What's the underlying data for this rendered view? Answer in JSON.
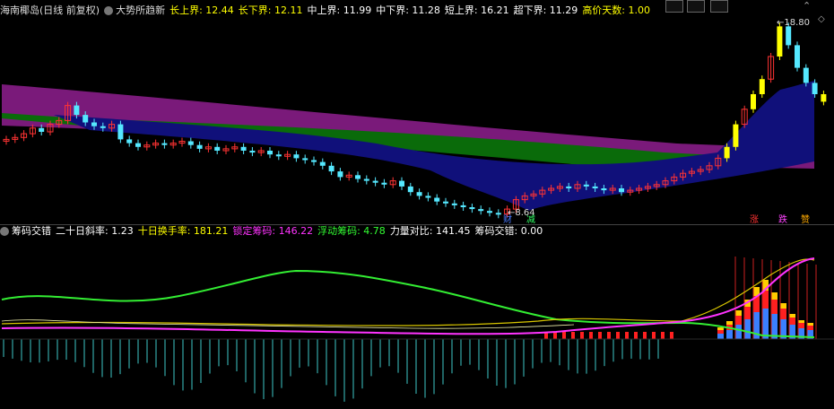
{
  "upper": {
    "title": "海南椰岛(日线 前复权)",
    "indicator": "大势所趋新",
    "fields": [
      {
        "label": "长上界:",
        "value": "12.44",
        "color": "#ffff00"
      },
      {
        "label": "长下界:",
        "value": "12.11",
        "color": "#ffff00"
      },
      {
        "label": "中上界:",
        "value": "11.99",
        "color": "#ffffff"
      },
      {
        "label": "中下界:",
        "value": "11.28",
        "color": "#ffffff"
      },
      {
        "label": "短上界:",
        "value": "16.21",
        "color": "#ffffff"
      },
      {
        "label": "超下界:",
        "value": "11.29",
        "color": "#ffffff"
      },
      {
        "label": "高价天数:",
        "value": "1.00",
        "color": "#ffff00"
      }
    ],
    "high_label": "18.80",
    "low_label": "8.64",
    "markers": [
      {
        "text": "财",
        "color": "#4b7cff"
      },
      {
        "text": "减",
        "color": "#33ff66"
      },
      {
        "text": "涨",
        "color": "#ff3333"
      },
      {
        "text": "跌",
        "color": "#ff44ff"
      },
      {
        "text": "赞",
        "color": "#ffaa00"
      }
    ]
  },
  "lower": {
    "fields": [
      {
        "label": "筹码交错",
        "value": "",
        "color": "#ffffff"
      },
      {
        "label": "二十日斜率:",
        "value": "1.23",
        "color": "#ffffff"
      },
      {
        "label": "十日换手率:",
        "value": "181.21",
        "color": "#ffff00"
      },
      {
        "label": "锁定筹码:",
        "value": "146.22",
        "color": "#ff33ff"
      },
      {
        "label": "浮动筹码:",
        "value": "4.78",
        "color": "#33ff33"
      },
      {
        "label": "力量对比:",
        "value": "141.45",
        "color": "#ffffff"
      },
      {
        "label": "筹码交错:",
        "value": "0.00",
        "color": "#ffffff"
      }
    ]
  },
  "colors": {
    "background": "#000000",
    "up": "#ff3333",
    "down": "#55e8ff",
    "purple_band": "#7a1a7a",
    "green_band": "#0a6b0a",
    "navy_band": "#10107a",
    "highlight": "#ffff00"
  }
}
